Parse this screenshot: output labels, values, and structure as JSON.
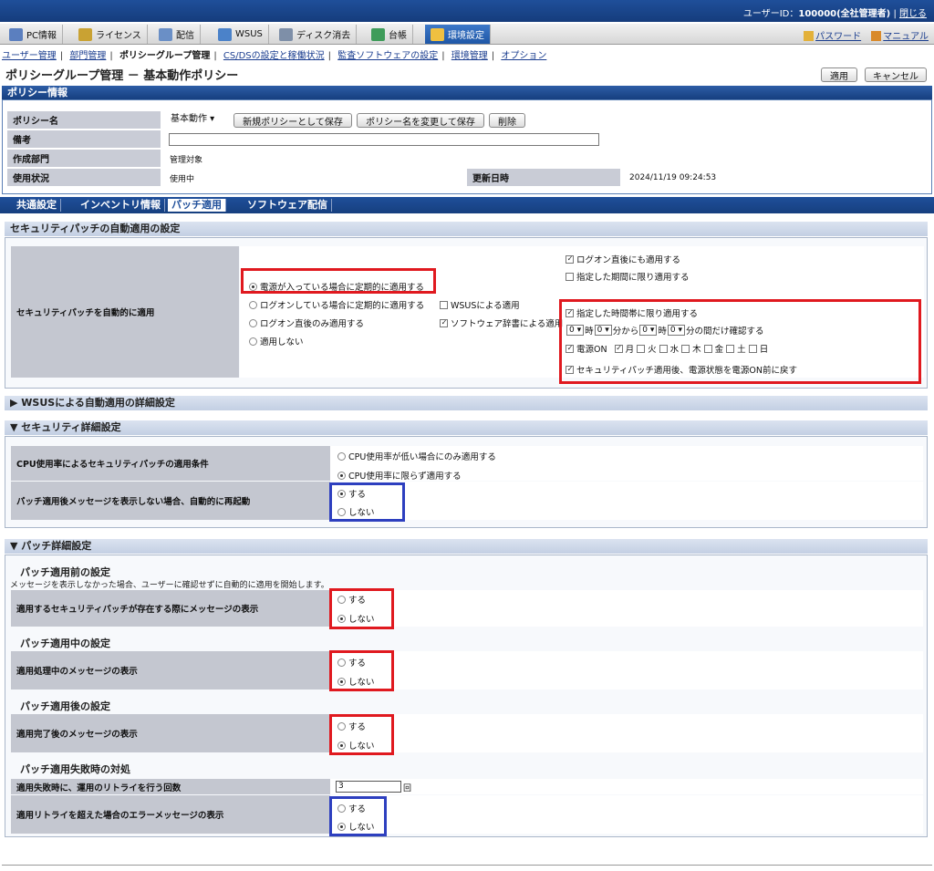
{
  "header": {
    "user_label": "ユーザーID：",
    "user_value": "100000(全社管理者)",
    "sep": "|",
    "close": "閉じる"
  },
  "nav": {
    "tabs": [
      "PC情報",
      "ライセンス",
      "配信",
      "WSUS",
      "ディスク消去",
      "台帳",
      "環境設定"
    ],
    "password": "パスワード",
    "manual": "マニュアル"
  },
  "subnav": {
    "items": [
      "ユーザー管理",
      "部門管理",
      "ポリシーグループ管理",
      "CS/DSの設定と稼働状況",
      "監査ソフトウェアの設定",
      "環境管理",
      "オプション"
    ]
  },
  "page": {
    "title": "ポリシーグループ管理 － 基本動作ポリシー",
    "apply": "適用",
    "cancel": "キャンセル"
  },
  "policy": {
    "section": "ポリシー情報",
    "name_label": "ポリシー名",
    "name_value": "基本動作",
    "save_new": "新規ポリシーとして保存",
    "save_rename": "ポリシー名を変更して保存",
    "delete": "削除",
    "note_label": "備考",
    "note_value": "",
    "dept_label": "作成部門",
    "dept_value": "管理対象",
    "status_label": "使用状況",
    "status_value": "使用中",
    "updated_label": "更新日時",
    "updated_value": "2024/11/19 09:24:53"
  },
  "tabs": [
    "共通設定",
    "インベントリ情報",
    "パッチ適用",
    "ソフトウェア配信"
  ],
  "auto": {
    "title": "セキュリティパッチの自動適用の設定",
    "label": "セキュリティパッチを自動的に適用",
    "opt1": "電源が入っている場合に定期的に適用する",
    "opt2": "ログオンしている場合に定期的に適用する",
    "opt3": "ログオン直後のみ適用する",
    "opt4": "適用しない",
    "wsus": "WSUSによる適用",
    "dict": "ソフトウェア辞書による適用",
    "logon_also": "ログオン直後にも適用する",
    "period_only": "指定した期間に限り適用する",
    "time_only": "指定した時間帯に限り適用する",
    "h1": "0",
    "ji1": "時",
    "m1": "0",
    "fun1": "分から",
    "h2": "0",
    "ji2": "時",
    "m2": "0",
    "fun2": "分の間だけ確認する",
    "power_on": "電源ON",
    "days": [
      "月",
      "火",
      "水",
      "木",
      "金",
      "土",
      "日"
    ],
    "restore": "セキュリティパッチ適用後、電源状態を電源ON前に戻す"
  },
  "wsus_detail": {
    "title": "WSUSによる自動適用の詳細設定"
  },
  "security": {
    "title": "セキュリティ詳細設定",
    "cpu_label": "CPU使用率によるセキュリティパッチの適用条件",
    "cpu_opt1": "CPU使用率が低い場合にのみ適用する",
    "cpu_opt2": "CPU使用率に限らず適用する",
    "reboot_label": "パッチ適用後メッセージを表示しない場合、自動的に再起動",
    "yes": "する",
    "no": "しない"
  },
  "patch": {
    "title": "パッチ詳細設定",
    "before_title": "パッチ適用前の設定",
    "before_note": "メッセージを表示しなかった場合、ユーザーに確認せずに自動的に適用を開始します。",
    "before_label": "適用するセキュリティパッチが存在する際にメッセージの表示",
    "during_title": "パッチ適用中の設定",
    "during_label": "適用処理中のメッセージの表示",
    "after_title": "パッチ適用後の設定",
    "after_label": "適用完了後のメッセージの表示",
    "fail_title": "パッチ適用失敗時の対処",
    "retry_label": "適用失敗時に、運用のリトライを行う回数",
    "retry_value": "3",
    "retry_unit": "回",
    "err_label": "適用リトライを超えた場合のエラーメッセージの表示",
    "yes": "する",
    "no": "しない"
  },
  "colors": {
    "accent": "#1f4f9a",
    "red": "#e0191f",
    "blue": "#2d3fbf"
  }
}
